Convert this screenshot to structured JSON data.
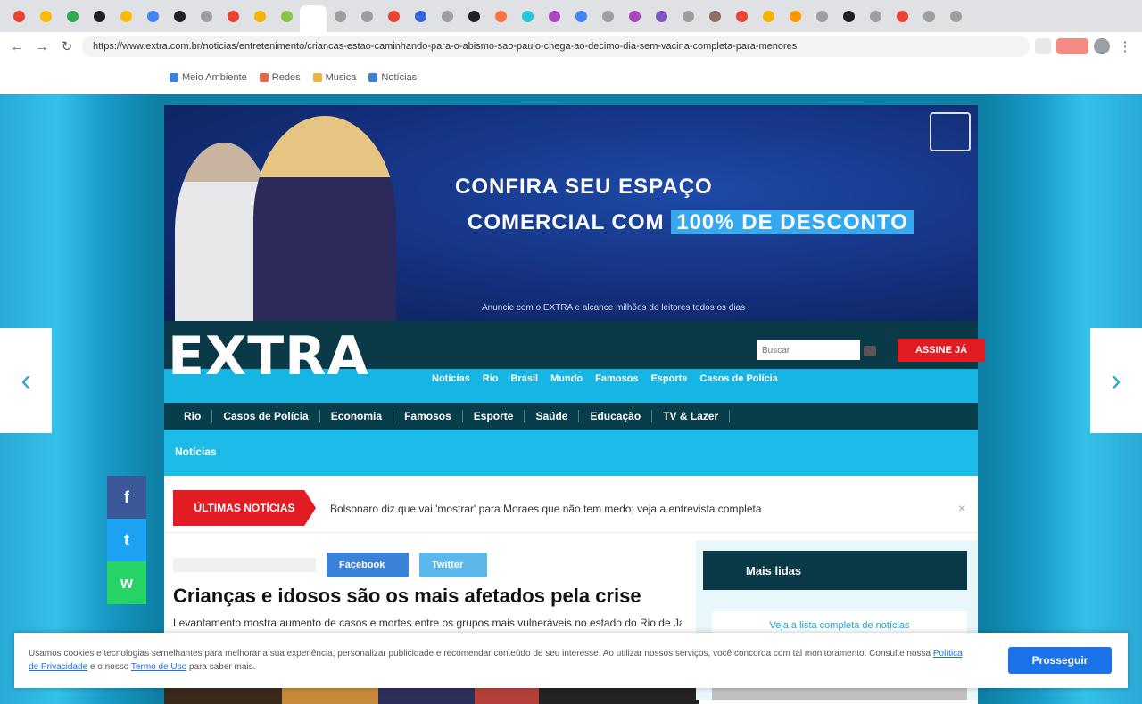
{
  "browser": {
    "tab_colors": [
      "#ea4335",
      "#fbbc05",
      "#34a853",
      "#202124",
      "#fbbc05",
      "#4285f4",
      "#202124",
      "#9e9e9e",
      "#ea4335",
      "#f4b400",
      "#8bc34a",
      "#ffffff",
      "#9e9e9e",
      "#9e9e9e",
      "#ea4335",
      "#3367d6",
      "#9e9e9e",
      "#202124",
      "#ff7043",
      "#26c6da",
      "#ab47bc",
      "#4285f4",
      "#9e9e9e",
      "#ab47bc",
      "#7e57c2",
      "#9e9e9e",
      "#8d6e63",
      "#ea4335",
      "#f4b400",
      "#ff9800",
      "#9e9e9e",
      "#202124",
      "#9e9e9e",
      "#ea4335",
      "#9e9e9e",
      "#9e9e9e"
    ],
    "url": "https://www.extra.com.br/noticias/entretenimento/criancas-estao-caminhando-para-o-abismo-sao-paulo-chega-ao-decimo-dia-sem-vacina-completa-para-menores"
  },
  "bookmarks": [
    {
      "label": "Meio Ambiente",
      "color": "#3b82d8"
    },
    {
      "label": "Redes",
      "color": "#e8644a"
    },
    {
      "label": "Musica",
      "color": "#f2b33d"
    },
    {
      "label": "Notícias",
      "color": "#3b82d8"
    }
  ],
  "hero": {
    "line1": "CONFIRA SEU ESPAÇO",
    "line2_prefix": "COMERCIAL COM",
    "line2_highlight": "100% DE DESCONTO",
    "footer": "Anuncie com o EXTRA e alcance milhões de leitores todos os dias"
  },
  "header": {
    "brand": "EXTRA",
    "search_placeholder": "Buscar",
    "cta": "ASSINE JÁ",
    "sublinks": [
      "Notícias",
      "Rio",
      "Brasil",
      "Mundo",
      "Famosos",
      "Esporte",
      "Casos de Polícia"
    ],
    "nav": [
      "Rio",
      "Casos de Polícia",
      "Economia",
      "Famosos",
      "Esporte",
      "Saúde",
      "Educação",
      "TV & Lazer"
    ],
    "breadcrumb": "Notícias"
  },
  "content": {
    "breaking_label": "ÚLTIMAS NOTÍCIAS",
    "ticker": "Bolsonaro diz que vai 'mostrar' para Moraes que não tem medo; veja a entrevista completa",
    "share_facebook": "Facebook",
    "share_twitter": "Twitter",
    "title": "Crianças e idosos são os mais afetados pela crise",
    "lead": "Levantamento mostra aumento de casos e mortes entre os grupos mais vulneráveis no estado do Rio de Janeiro",
    "sidebar_heading": "Mais lidas",
    "sidebar_link": "Veja a lista completa de notícias"
  },
  "social": [
    {
      "name": "facebook-icon",
      "glyph": "f",
      "color": "#3b5998"
    },
    {
      "name": "twitter-icon",
      "glyph": "t",
      "color": "#1da1f2"
    },
    {
      "name": "whatsapp-icon",
      "glyph": "w",
      "color": "#25d366"
    }
  ],
  "cookie": {
    "text_before": "Usamos cookies e tecnologias semelhantes para melhorar a sua experiência, personalizar publicidade e recomendar conteúdo de seu interesse. Ao utilizar nossos serviços, você concorda com tal monitoramento. Consulte nossa",
    "link1": "Política de Privacidade",
    "text_middle": "e o nosso",
    "link2": "Termo de Uso",
    "text_after": "para saber mais.",
    "button": "Prosseguir"
  }
}
